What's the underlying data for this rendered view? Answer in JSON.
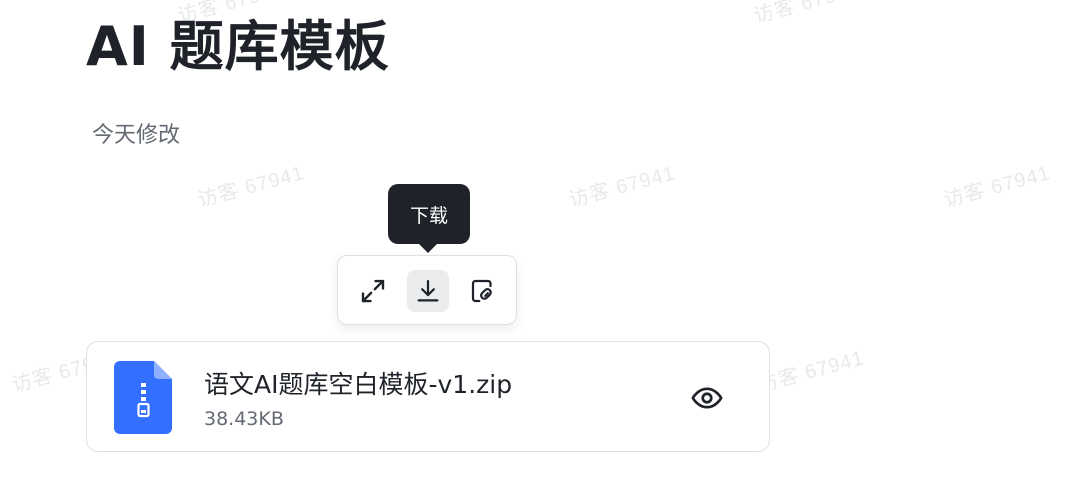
{
  "watermark": "访客 67941",
  "document": {
    "title": "AI 题库模板",
    "modified": "今天修改"
  },
  "tooltip": {
    "text": "下载"
  },
  "toolbar": {
    "buttons": [
      {
        "icon": "expand-icon"
      },
      {
        "icon": "download-icon",
        "active": true
      },
      {
        "icon": "copy-link-icon"
      }
    ]
  },
  "attachment": {
    "file_name": "语文AI题库空白模板-v1.zip",
    "file_size": "38.43KB",
    "icon": "zip-file-icon",
    "icon_color": "#3370ff",
    "preview_icon": "eye-icon"
  }
}
